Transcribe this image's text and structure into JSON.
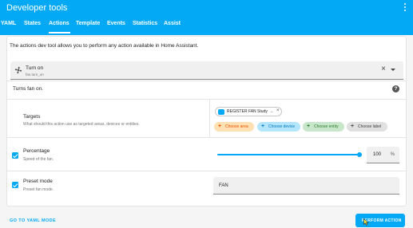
{
  "app": {
    "title": "Developer tools",
    "tabs": [
      {
        "label": "YAML"
      },
      {
        "label": "States"
      },
      {
        "label": "Actions"
      },
      {
        "label": "Template"
      },
      {
        "label": "Events"
      },
      {
        "label": "Statistics"
      },
      {
        "label": "Assist"
      }
    ],
    "active_tab": "Actions",
    "accent": "#03a9f4"
  },
  "main": {
    "intro": "The actions dev tool allows you to perform any action available in Home Assistant.",
    "action": {
      "name": "Turn on",
      "id": "fan.turn_on",
      "icon": "fan-icon"
    },
    "description": "Turns fan on.",
    "targets": {
      "label": "Targets",
      "help": "What should this action use as targeted areas, devices or entities.",
      "selected_device": "REGISTER FAN Study",
      "add_chips": [
        {
          "label": "Choose area",
          "color": "#ffe0b2",
          "text_color": "#e65100"
        },
        {
          "label": "Choose device",
          "color": "#b3e5fc",
          "text_color": "#0277bd"
        },
        {
          "label": "Choose entity",
          "color": "#c8e6c9",
          "text_color": "#2e7d32"
        },
        {
          "label": "Choose label",
          "color": "#e0e0e0",
          "text_color": "#424242"
        }
      ]
    },
    "percentage": {
      "label": "Percentage",
      "help": "Speed of the fan.",
      "value": "100",
      "unit": "%",
      "checked": true
    },
    "preset_mode": {
      "label": "Preset mode",
      "help": "Preset fan mode.",
      "value": "FAN",
      "checked": true
    }
  },
  "footer": {
    "yaml_link": "GO TO YAML MODE",
    "perform_button": "PERFORM ACTION"
  }
}
